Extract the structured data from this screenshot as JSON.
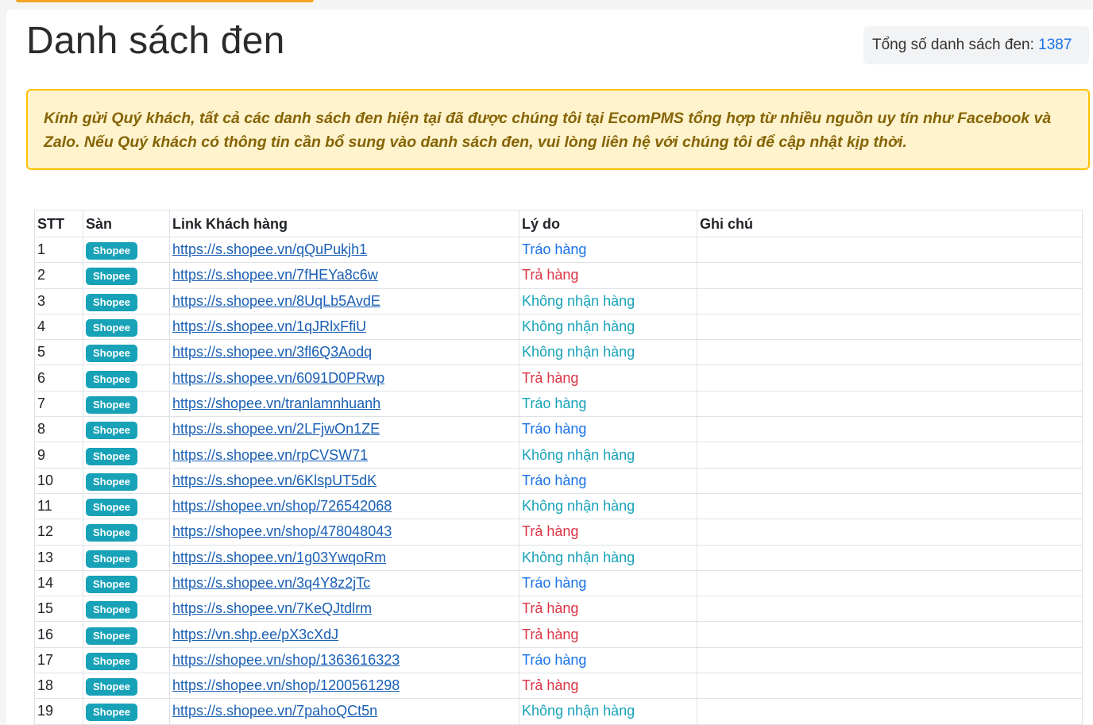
{
  "page": {
    "title": "Danh sách đen",
    "total_label": "Tổng số danh sách đen:",
    "total_count": "1387",
    "notice": "Kính gửi Quý khách, tất cả các danh sách đen hiện tại đã được chúng tôi tại EcomPMS tổng hợp từ nhiều nguồn uy tín như Facebook và Zalo. Nếu Quý khách có thông tin cần bổ sung vào danh sách đen, vui lòng liên hệ với chúng tôi để cập nhật kịp thời."
  },
  "table": {
    "headers": [
      "STT",
      "Sàn",
      "Link Khách hàng",
      "Lý do",
      "Ghi chú"
    ],
    "rows": [
      {
        "stt": "1",
        "platform": "Shopee",
        "link": "https://s.shopee.vn/qQuPukjh1",
        "reason": "Tráo hàng",
        "reason_color": "#1a73e8",
        "note": ""
      },
      {
        "stt": "2",
        "platform": "Shopee",
        "link": "https://s.shopee.vn/7fHEYa8c6w",
        "reason": "Trả hàng",
        "reason_color": "#dc3545",
        "note": ""
      },
      {
        "stt": "3",
        "platform": "Shopee",
        "link": "https://s.shopee.vn/8UqLb5AvdE",
        "reason": "Không nhận hàng",
        "reason_color": "#17a2b8",
        "note": ""
      },
      {
        "stt": "4",
        "platform": "Shopee",
        "link": "https://s.shopee.vn/1qJRlxFfiU",
        "reason": "Không nhận hàng",
        "reason_color": "#17a2b8",
        "note": ""
      },
      {
        "stt": "5",
        "platform": "Shopee",
        "link": "https://s.shopee.vn/3fl6Q3Aodq",
        "reason": "Không nhận hàng",
        "reason_color": "#17a2b8",
        "note": ""
      },
      {
        "stt": "6",
        "platform": "Shopee",
        "link": "https://s.shopee.vn/6091D0PRwp",
        "reason": "Trả hàng",
        "reason_color": "#dc3545",
        "note": ""
      },
      {
        "stt": "7",
        "platform": "Shopee",
        "link": "https://shopee.vn/tranlamnhuanh",
        "reason": "Tráo hàng",
        "reason_color": "#17a2b8",
        "note": ""
      },
      {
        "stt": "8",
        "platform": "Shopee",
        "link": "https://s.shopee.vn/2LFjwOn1ZE",
        "reason": "Tráo hàng",
        "reason_color": "#1a73e8",
        "note": ""
      },
      {
        "stt": "9",
        "platform": "Shopee",
        "link": "https://s.shopee.vn/rpCVSW71",
        "reason": "Không nhận hàng",
        "reason_color": "#17a2b8",
        "note": ""
      },
      {
        "stt": "10",
        "platform": "Shopee",
        "link": "https://s.shopee.vn/6KlspUT5dK",
        "reason": "Tráo hàng",
        "reason_color": "#1a73e8",
        "note": ""
      },
      {
        "stt": "11",
        "platform": "Shopee",
        "link": "https://shopee.vn/shop/726542068",
        "reason": "Không nhận hàng",
        "reason_color": "#17a2b8",
        "note": ""
      },
      {
        "stt": "12",
        "platform": "Shopee",
        "link": "https://shopee.vn/shop/478048043",
        "reason": "Trả hàng",
        "reason_color": "#dc3545",
        "note": ""
      },
      {
        "stt": "13",
        "platform": "Shopee",
        "link": "https://s.shopee.vn/1g03YwqoRm",
        "reason": "Không nhận hàng",
        "reason_color": "#17a2b8",
        "note": ""
      },
      {
        "stt": "14",
        "platform": "Shopee",
        "link": "https://s.shopee.vn/3q4Y8z2jTc",
        "reason": "Tráo hàng",
        "reason_color": "#1a73e8",
        "note": ""
      },
      {
        "stt": "15",
        "platform": "Shopee",
        "link": "https://s.shopee.vn/7KeQJtdlrm",
        "reason": "Trả hàng",
        "reason_color": "#dc3545",
        "note": ""
      },
      {
        "stt": "16",
        "platform": "Shopee",
        "link": "https://vn.shp.ee/pX3cXdJ",
        "reason": "Trả hàng",
        "reason_color": "#dc3545",
        "note": ""
      },
      {
        "stt": "17",
        "platform": "Shopee",
        "link": "https://shopee.vn/shop/1363616323",
        "reason": "Tráo hàng",
        "reason_color": "#1a73e8",
        "note": ""
      },
      {
        "stt": "18",
        "platform": "Shopee",
        "link": "https://shopee.vn/shop/1200561298",
        "reason": "Trả hàng",
        "reason_color": "#dc3545",
        "note": ""
      },
      {
        "stt": "19",
        "platform": "Shopee",
        "link": "https://s.shopee.vn/7pahoQCt5n",
        "reason": "Không nhận hàng",
        "reason_color": "#17a2b8",
        "note": ""
      }
    ]
  },
  "colors": {
    "platform_badge": "#17a2b8",
    "link": "#1a5fb4",
    "accent": "#1a73e8",
    "alert_bg": "#fff3cd",
    "alert_border": "#ffc107"
  }
}
